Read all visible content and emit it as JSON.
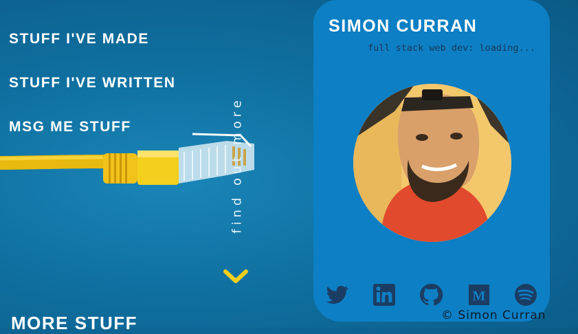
{
  "nav": {
    "items": [
      {
        "label": "STUFF I'VE MADE"
      },
      {
        "label": "STUFF I'VE WRITTEN"
      },
      {
        "label": "MSG ME STUFF"
      }
    ]
  },
  "scroll_hint": {
    "text": "find out more",
    "icon": "chevron-down-icon",
    "color": "#f4cf1d"
  },
  "section": {
    "title": "MORE STUFF"
  },
  "profile": {
    "name": "SIMON CURRAN",
    "tagline": "full stack web dev: loading...",
    "social": [
      "twitter-icon",
      "linkedin-icon",
      "github-icon",
      "medium-icon",
      "spotify-icon"
    ]
  },
  "footer": {
    "copyright": "© Simon Curran"
  },
  "colors": {
    "card": "#0d7fc4",
    "icon": "#1b3d63",
    "accent": "#f4cf1d"
  }
}
